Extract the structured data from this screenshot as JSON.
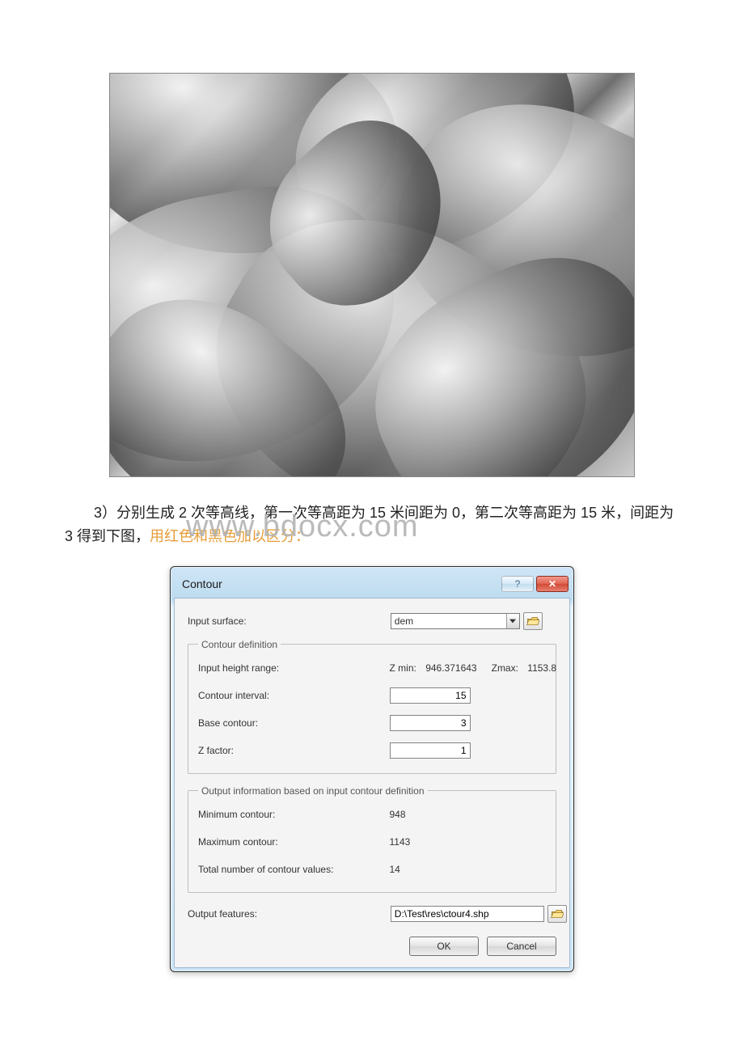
{
  "caption_prefix": "3）",
  "caption_black_1": "分别生成 2 次等高线，第一次等高距为 15 米间距为 0，第二次等高距为 15 米，间距为 3 得到下图，",
  "caption_orange": "用红色和黑色加以区分：",
  "watermark": "www.bdocx.com",
  "dialog": {
    "title": "Contour",
    "input_surface_label": "Input surface:",
    "input_surface_value": "dem",
    "group1_legend": "Contour definition",
    "height_range_label": "Input height range:",
    "zmin_label": "Z min:",
    "zmin_value": "946.371643",
    "zmax_label": "Zmax:",
    "zmax_value": "1153.8",
    "contour_interval_label": "Contour interval:",
    "contour_interval_value": "15",
    "base_contour_label": "Base contour:",
    "base_contour_value": "3",
    "z_factor_label": "Z factor:",
    "z_factor_value": "1",
    "group2_legend": "Output information based on input contour definition",
    "min_contour_label": "Minimum contour:",
    "min_contour_value": "948",
    "max_contour_label": "Maximum contour:",
    "max_contour_value": "1143",
    "total_label": "Total number of contour values:",
    "total_value": "14",
    "output_features_label": "Output features:",
    "output_features_value": "D:\\Test\\res\\ctour4.shp",
    "ok_label": "OK",
    "cancel_label": "Cancel"
  }
}
